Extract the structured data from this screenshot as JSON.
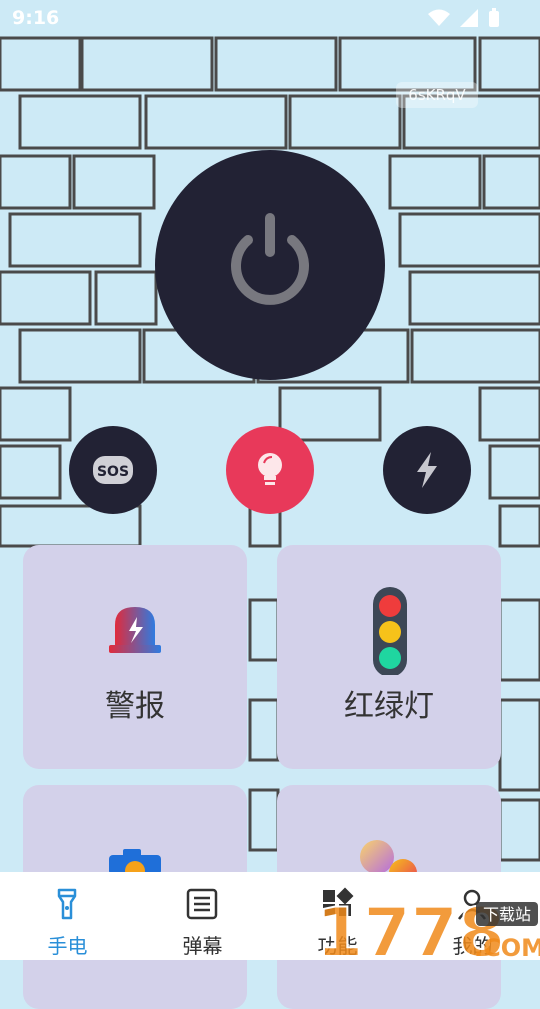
{
  "status": {
    "time": "9:16"
  },
  "watermark": "6sKRqV",
  "controls": {
    "power": {
      "icon": "power-icon"
    },
    "modes": [
      {
        "name": "sos",
        "text": "SOS",
        "icon": "sos-icon",
        "active": false
      },
      {
        "name": "bulb",
        "icon": "bulb-icon",
        "active": true
      },
      {
        "name": "flash",
        "icon": "flash-icon",
        "active": false
      }
    ]
  },
  "features": [
    {
      "label": "警报",
      "icon": "siren-icon"
    },
    {
      "label": "红绿灯",
      "icon": "traffic-light-icon"
    },
    {
      "label": "",
      "icon": "camera-icon"
    },
    {
      "label": "",
      "icon": "color-bubbles-icon"
    }
  ],
  "bottom_nav": {
    "items": [
      {
        "label": "手电",
        "icon": "flashlight-icon",
        "active": true
      },
      {
        "label": "弹幕",
        "icon": "barrage-icon",
        "active": false
      },
      {
        "label": "功能",
        "icon": "function-icon",
        "active": false
      },
      {
        "label": "我的",
        "icon": "profile-icon",
        "active": false
      }
    ]
  },
  "site_logo": {
    "text": "1778",
    "suffix": "下载站",
    "domain": ".COM"
  },
  "colors": {
    "background": "#cdeaf6",
    "dark": "#222234",
    "accent": "#e8395a",
    "card": "#d3d1ea",
    "nav_active": "#2a8fd8"
  }
}
